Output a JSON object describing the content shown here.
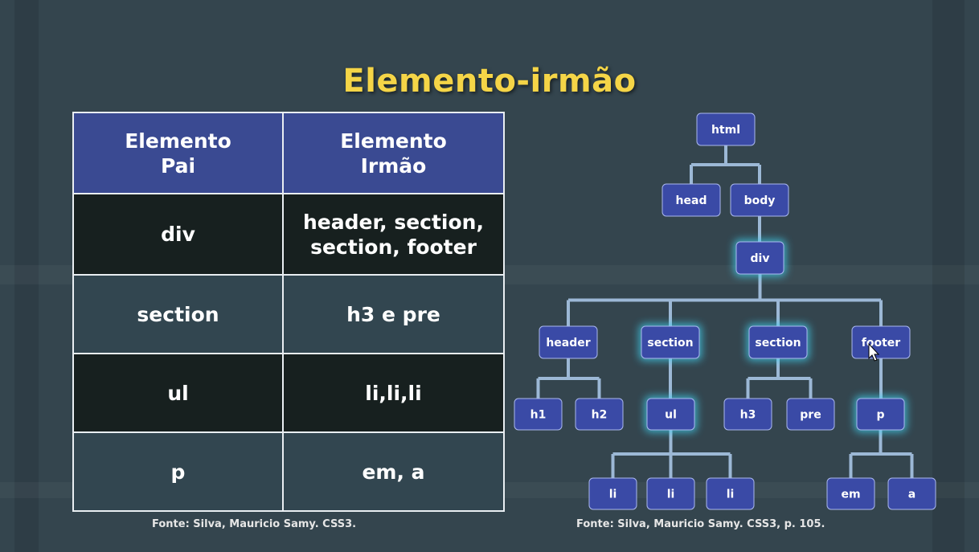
{
  "title": "Elemento-irmão",
  "table": {
    "headers": [
      [
        "Elemento",
        "Pai"
      ],
      [
        "Elemento",
        "Irmão"
      ]
    ],
    "rows": [
      {
        "parent": [
          "div"
        ],
        "siblings": [
          "header, section,",
          "section, footer"
        ]
      },
      {
        "parent": [
          "section"
        ],
        "siblings": [
          "h3 e pre"
        ]
      },
      {
        "parent": [
          "ul"
        ],
        "siblings": [
          "li,li,li"
        ]
      },
      {
        "parent": [
          "p"
        ],
        "siblings": [
          "em, a"
        ]
      }
    ]
  },
  "caption_left": "Fonte: Silva, Mauricio Samy. CSS3.",
  "caption_right": "Fonte: Silva, Mauricio Samy. CSS3, p. 105.",
  "tree": {
    "nodes": [
      {
        "id": "html",
        "label": "html",
        "highlight": false
      },
      {
        "id": "head",
        "label": "head",
        "highlight": false
      },
      {
        "id": "body",
        "label": "body",
        "highlight": false
      },
      {
        "id": "div",
        "label": "div",
        "highlight": true
      },
      {
        "id": "header",
        "label": "header",
        "highlight": false
      },
      {
        "id": "section1",
        "label": "section",
        "highlight": true
      },
      {
        "id": "section2",
        "label": "section",
        "highlight": true
      },
      {
        "id": "footer",
        "label": "footer",
        "highlight": false
      },
      {
        "id": "h1",
        "label": "h1",
        "highlight": false
      },
      {
        "id": "h2",
        "label": "h2",
        "highlight": false
      },
      {
        "id": "ul",
        "label": "ul",
        "highlight": true
      },
      {
        "id": "h3",
        "label": "h3",
        "highlight": false
      },
      {
        "id": "pre",
        "label": "pre",
        "highlight": false
      },
      {
        "id": "p",
        "label": "p",
        "highlight": true
      },
      {
        "id": "li1",
        "label": "li",
        "highlight": false
      },
      {
        "id": "li2",
        "label": "li",
        "highlight": false
      },
      {
        "id": "li3",
        "label": "li",
        "highlight": false
      },
      {
        "id": "em",
        "label": "em",
        "highlight": false
      },
      {
        "id": "a",
        "label": "a",
        "highlight": false
      }
    ],
    "edges": [
      [
        "html",
        "head"
      ],
      [
        "html",
        "body"
      ],
      [
        "body",
        "div"
      ],
      [
        "div",
        "header"
      ],
      [
        "div",
        "section1"
      ],
      [
        "div",
        "section2"
      ],
      [
        "div",
        "footer"
      ],
      [
        "header",
        "h1"
      ],
      [
        "header",
        "h2"
      ],
      [
        "section1",
        "ul"
      ],
      [
        "section2",
        "h3"
      ],
      [
        "section2",
        "pre"
      ],
      [
        "footer",
        "p"
      ],
      [
        "ul",
        "li1"
      ],
      [
        "ul",
        "li2"
      ],
      [
        "ul",
        "li3"
      ],
      [
        "p",
        "em"
      ],
      [
        "p",
        "a"
      ]
    ]
  },
  "colors": {
    "title": "#f5d547",
    "header_row": "#3a4a92",
    "dark_row": "#17201f",
    "light_row": "#324650",
    "node_fill": "#3a4aa6",
    "node_glow": "#3fd0f0",
    "edge": "#9cb8d6"
  }
}
